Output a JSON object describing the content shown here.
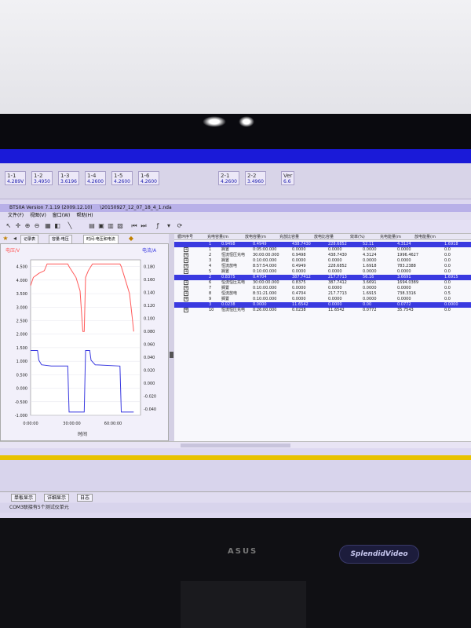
{
  "app": {
    "title": "BTS0A Version 7.1.19 (2009.12.10)",
    "path": "\\20150927_12_07_18_4_1.nda"
  },
  "channels": [
    {
      "label": "1-1",
      "value": "4.289V"
    },
    {
      "label": "1-2",
      "value": "3.4950"
    },
    {
      "label": "1-3",
      "value": "3.6196"
    },
    {
      "label": "1-4",
      "value": "4.2600"
    },
    {
      "label": "1-5",
      "value": "4.2600"
    },
    {
      "label": "1-6",
      "value": "4.2600"
    },
    {
      "label": "2-1",
      "value": "4.2600"
    },
    {
      "label": "2-2",
      "value": "3.4960"
    },
    {
      "label": "Ver",
      "value": "6.6"
    }
  ],
  "menu": [
    "文件(F)",
    "视图(V)",
    "窗口(W)",
    "帮助(H)"
  ],
  "tabs": [
    {
      "label": "记录表"
    },
    {
      "label": "容量-电压"
    },
    {
      "label": "时间-电压和电流",
      "active": true
    }
  ],
  "chart": {
    "y_left_title": "电压/V",
    "y_right_title": "电流/A",
    "x_title": "时间",
    "y_left_ticks": [
      "4.500",
      "4.000",
      "3.500",
      "3.000",
      "2.500",
      "2.000",
      "1.500",
      "1.000",
      "0.500",
      "0.000",
      "-0.500",
      "-1.000"
    ],
    "y_right_ticks": [
      "0.180",
      "0.160",
      "0.140",
      "0.120",
      "0.100",
      "0.080",
      "0.060",
      "0.040",
      "0.020",
      "0.000",
      "-0.020",
      "-0.040"
    ],
    "x_ticks": [
      "0:00:00",
      "30:00:00",
      "60:00:00"
    ],
    "colors": {
      "voltage": "#ff5a5a",
      "current": "#3a3ae0"
    }
  },
  "chart_data": {
    "type": "line",
    "xlabel": "时间",
    "ylabel": "电压/V",
    "y2label": "电流/A",
    "ylim": [
      -1.0,
      4.75
    ],
    "y2lim": [
      -0.05,
      0.19
    ],
    "series": [
      {
        "name": "电压/V",
        "axis": "left",
        "points": [
          [
            0,
            3.8
          ],
          [
            2,
            4.1
          ],
          [
            6,
            4.25
          ],
          [
            10,
            4.35
          ],
          [
            12,
            4.6
          ],
          [
            27,
            4.6
          ],
          [
            28,
            4.5
          ],
          [
            33,
            4.1
          ],
          [
            36,
            3.6
          ],
          [
            38,
            2.1
          ],
          [
            39,
            2.1
          ],
          [
            40,
            4.1
          ],
          [
            42,
            4.35
          ],
          [
            45,
            4.6
          ],
          [
            65,
            4.6
          ],
          [
            66,
            4.5
          ],
          [
            69,
            4.0
          ],
          [
            72,
            3.5
          ],
          [
            74,
            2.6
          ],
          [
            75,
            2.1
          ]
        ]
      },
      {
        "name": "电流/A",
        "axis": "right",
        "points": [
          [
            0,
            0.05
          ],
          [
            5,
            0.05
          ],
          [
            6,
            0.035
          ],
          [
            8,
            0.028
          ],
          [
            15,
            0.026
          ],
          [
            27,
            0.026
          ],
          [
            28,
            -0.045
          ],
          [
            39,
            -0.045
          ],
          [
            40,
            0.05
          ],
          [
            43,
            0.05
          ],
          [
            44,
            0.035
          ],
          [
            47,
            0.028
          ],
          [
            65,
            0.026
          ],
          [
            66,
            -0.045
          ],
          [
            75,
            -0.045
          ]
        ]
      }
    ]
  },
  "grid": {
    "headers": [
      "循环序号",
      "充电容量(m",
      "放电容量(m",
      "充放比容量",
      "放电比容量",
      "效率(%)",
      "充电能量(m",
      "放电能量(m"
    ],
    "rows": [
      {
        "type": "parent",
        "cells": [
          "",
          "1",
          "0.9498",
          "0.4949",
          "438.7430",
          "228.6852",
          "52.11",
          "4.3124",
          "1.6918"
        ]
      },
      {
        "type": "child",
        "cells": [
          "+",
          "1",
          "搁置",
          "0:05:00.000",
          "0.0000",
          "0.0000",
          "0.0000",
          "0.0000",
          "0.0"
        ]
      },
      {
        "type": "child",
        "cells": [
          "+",
          "2",
          "恒流恒压充电",
          "30:00:00.000",
          "0.9498",
          "438.7430",
          "4.3124",
          "1996.4627",
          "0.0"
        ]
      },
      {
        "type": "child",
        "cells": [
          "+",
          "3",
          "搁置",
          "0:10:00.000",
          "0.0000",
          "0.0000",
          "0.0000",
          "0.0000",
          "0.0"
        ]
      },
      {
        "type": "child",
        "cells": [
          "+",
          "4",
          "恒流放电",
          "8:57:54.000",
          "0.4949",
          "228.6852",
          "1.6918",
          "783.2388",
          "0.0"
        ]
      },
      {
        "type": "child",
        "cells": [
          "+",
          "5",
          "搁置",
          "0:10:00.000",
          "0.0000",
          "0.0000",
          "0.0000",
          "0.0000",
          "0.0"
        ]
      },
      {
        "type": "parent",
        "cells": [
          "",
          "2",
          "0.8375",
          "0.4704",
          "387.7412",
          "217.7713",
          "56.16",
          "3.6691",
          "1.6915"
        ]
      },
      {
        "type": "child",
        "cells": [
          "+",
          "6",
          "恒流恒压充电",
          "30:00:00.000",
          "0.8375",
          "387.7412",
          "3.6691",
          "1694.0389",
          "0.0"
        ]
      },
      {
        "type": "child",
        "cells": [
          "+",
          "7",
          "搁置",
          "0:10:00.000",
          "0.0000",
          "0.0000",
          "0.0000",
          "0.0000",
          "0.0"
        ]
      },
      {
        "type": "child",
        "cells": [
          "+",
          "8",
          "恒流放电",
          "8:31:21.000",
          "0.4704",
          "217.7713",
          "1.6915",
          "738.3316",
          "0.5"
        ]
      },
      {
        "type": "child",
        "cells": [
          "+",
          "9",
          "搁置",
          "0:10:00.000",
          "0.0000",
          "0.0000",
          "0.0000",
          "0.0000",
          "0.0"
        ]
      },
      {
        "type": "parent",
        "cells": [
          "",
          "3",
          "0.0238",
          "0.0000",
          "11.6542",
          "0.0000",
          "0.00",
          "0.0772",
          "0.0000"
        ]
      },
      {
        "type": "child",
        "cells": [
          "+",
          "10",
          "恒流恒压充电",
          "0:26:00.000",
          "0.0238",
          "11.6542",
          "0.0772",
          "35.7543",
          "0.0"
        ]
      }
    ]
  },
  "bottom_tabs": [
    "单板显示",
    "详细显示",
    "日志"
  ],
  "status": "COM3联接有5个测试仪单元",
  "monitor": {
    "brand": "ASUS",
    "badge": "SplendidVideo"
  }
}
